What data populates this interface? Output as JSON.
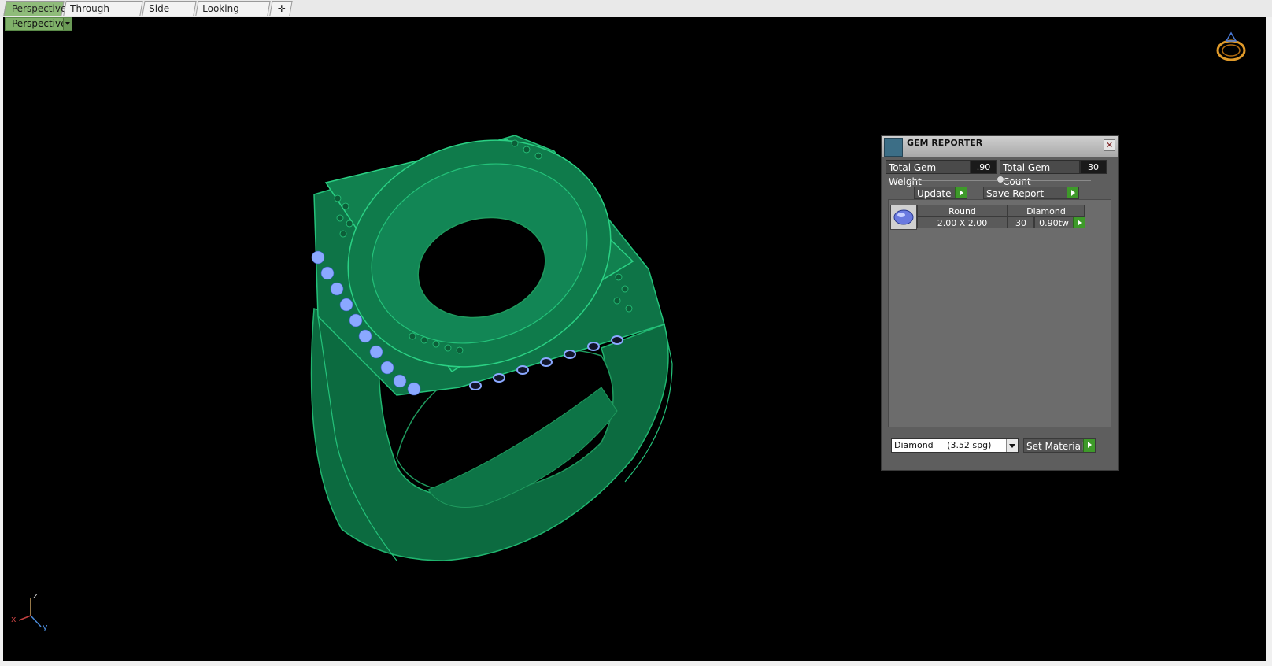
{
  "tabs": [
    "Perspective",
    "Through Finger",
    "Side View",
    "Looking Down"
  ],
  "add_tab_icon": "plus-icon",
  "viewport": {
    "label": "Perspective"
  },
  "axes": {
    "x": "x",
    "y": "y",
    "z": "z"
  },
  "panel": {
    "title": "GEM REPORTER",
    "total_weight_label": "Total Gem Weight",
    "total_weight_value": ".90",
    "total_count_label": "Total Gem Count",
    "total_count_value": "30",
    "update_label": "Update",
    "save_label": "Save Report",
    "row": {
      "shape": "Round",
      "material": "Diamond",
      "size": "2.00 X 2.00",
      "count": "30",
      "weight": "0.90tw"
    },
    "material_select": "Diamond     (3.52 spg)",
    "set_material_label": "Set Material"
  },
  "colors": {
    "ring": "#0f7a4a",
    "ring_edge": "#24c27a",
    "gems": "#8aa8ff",
    "panel": "#5e5e5e"
  }
}
